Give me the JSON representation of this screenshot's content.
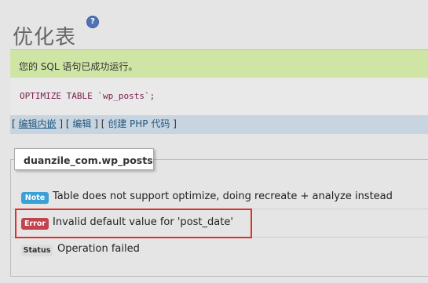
{
  "header": {
    "title": "优化表",
    "help_icon": "help-icon",
    "help_glyph": "?"
  },
  "success": {
    "message": "您的 SQL 语句已成功运行。"
  },
  "query": {
    "keyword": "OPTIMIZE TABLE",
    "table": "`wp_posts`",
    "terminator": ";"
  },
  "links": {
    "open": "[",
    "sep1": "] [",
    "sep2": "] [",
    "close": "]",
    "edit_inline": "编辑内嵌",
    "edit": "编辑",
    "create_php": "创建 PHP 代码"
  },
  "result": {
    "legend": "duanzile_com.wp_posts",
    "rows": [
      {
        "badge": "Note",
        "type": "note",
        "message": "Table does not support optimize, doing recreate + analyze instead"
      },
      {
        "badge": "Error",
        "type": "error",
        "message": "Invalid default value for 'post_date'"
      },
      {
        "badge": "Status",
        "type": "status",
        "message": "Operation failed"
      }
    ]
  },
  "colors": {
    "success_bg": "#cfe5a5",
    "links_bg": "#c8d4df",
    "note_badge": "#3aa0d6",
    "error_badge": "#c2434c",
    "highlight": "#e0302d"
  }
}
